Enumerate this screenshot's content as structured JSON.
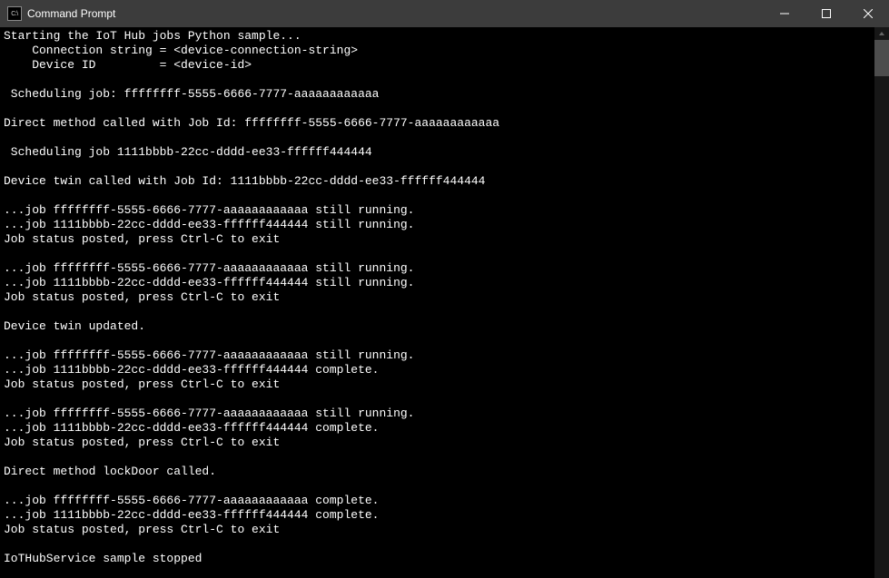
{
  "window": {
    "title": "Command Prompt",
    "icon_text": "C:\\"
  },
  "terminal": {
    "lines": [
      "Starting the IoT Hub jobs Python sample...",
      "    Connection string = <device-connection-string>",
      "    Device ID         = <device-id>",
      "",
      " Scheduling job: ffffffff-5555-6666-7777-aaaaaaaaaaaa",
      "",
      "Direct method called with Job Id: ffffffff-5555-6666-7777-aaaaaaaaaaaa",
      "",
      " Scheduling job 1111bbbb-22cc-dddd-ee33-ffffff444444",
      "",
      "Device twin called with Job Id: 1111bbbb-22cc-dddd-ee33-ffffff444444",
      "",
      "...job ffffffff-5555-6666-7777-aaaaaaaaaaaa still running.",
      "...job 1111bbbb-22cc-dddd-ee33-ffffff444444 still running.",
      "Job status posted, press Ctrl-C to exit",
      "",
      "...job ffffffff-5555-6666-7777-aaaaaaaaaaaa still running.",
      "...job 1111bbbb-22cc-dddd-ee33-ffffff444444 still running.",
      "Job status posted, press Ctrl-C to exit",
      "",
      "Device twin updated.",
      "",
      "...job ffffffff-5555-6666-7777-aaaaaaaaaaaa still running.",
      "...job 1111bbbb-22cc-dddd-ee33-ffffff444444 complete.",
      "Job status posted, press Ctrl-C to exit",
      "",
      "...job ffffffff-5555-6666-7777-aaaaaaaaaaaa still running.",
      "...job 1111bbbb-22cc-dddd-ee33-ffffff444444 complete.",
      "Job status posted, press Ctrl-C to exit",
      "",
      "Direct method lockDoor called.",
      "",
      "...job ffffffff-5555-6666-7777-aaaaaaaaaaaa complete.",
      "...job 1111bbbb-22cc-dddd-ee33-ffffff444444 complete.",
      "Job status posted, press Ctrl-C to exit",
      "",
      "IoTHubService sample stopped"
    ]
  }
}
